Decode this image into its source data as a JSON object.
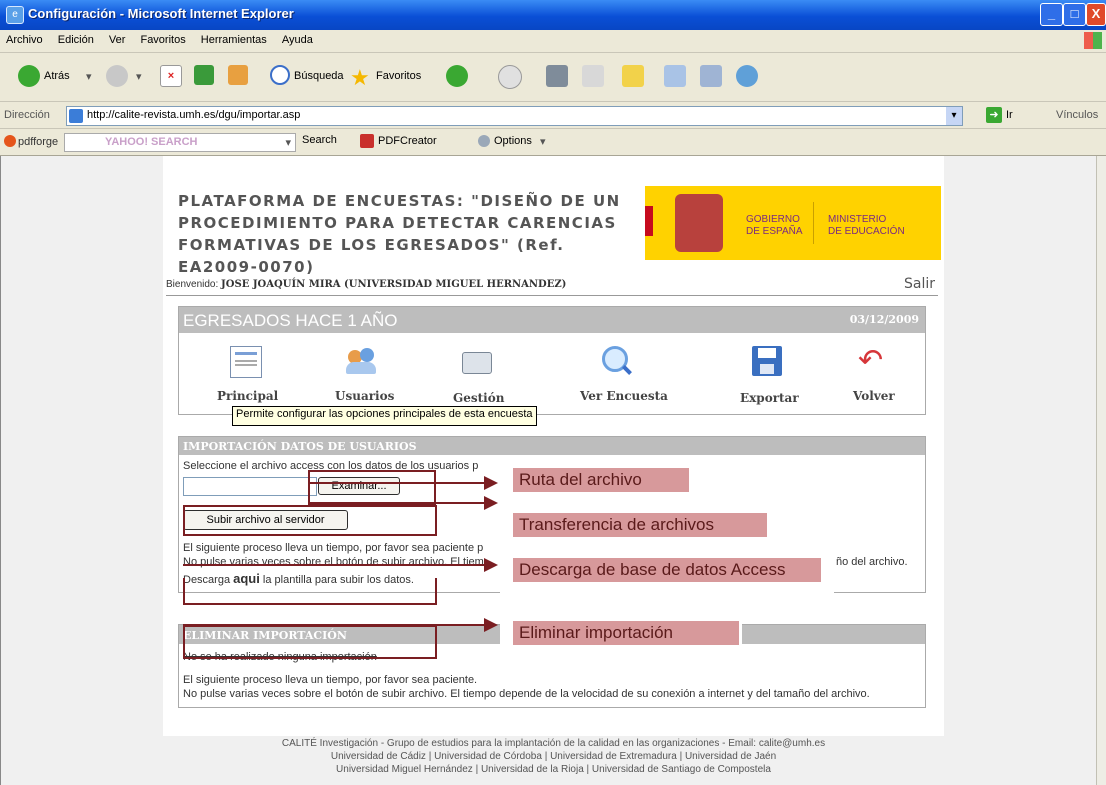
{
  "window": {
    "title": "Configuración - Microsoft Internet Explorer",
    "minimize": "_",
    "maximize": "□",
    "close": "X"
  },
  "menu": [
    "Archivo",
    "Edición",
    "Ver",
    "Favoritos",
    "Herramientas",
    "Ayuda"
  ],
  "toolbar": {
    "back": "Atrás",
    "search": "Búsqueda",
    "favorites": "Favoritos"
  },
  "address": {
    "label": "Dirección",
    "url": "http://calite-revista.umh.es/dgu/importar.asp",
    "go": "Ir",
    "links": "Vínculos"
  },
  "yahoobar": {
    "pdfforge": "pdfforge",
    "search_placeholder": "YAHOO! SEARCH",
    "search_button": "Search",
    "pdfcreator": "PDFCreator",
    "options": "Options"
  },
  "header": {
    "title_lines": [
      "PLATAFORMA DE ENCUESTAS: \"DISEÑO DE UN",
      "PROCEDIMIENTO PARA DETECTAR CARENCIAS",
      "FORMATIVAS DE LOS EGRESADOS\" (Ref. EA2009-0070)"
    ],
    "logo_gob_1": "GOBIERNO",
    "logo_gob_2": "DE ESPAÑA",
    "logo_min_1": "MINISTERIO",
    "logo_min_2": "DE EDUCACIÓN"
  },
  "user": {
    "welcome_label": "Bienvenido:",
    "name": "JOSE JOAQUÍN MIRA (UNIVERSIDAD MIGUEL HERNANDEZ)",
    "logout": "Salir"
  },
  "survey": {
    "title": "EGRESADOS HACE 1 AÑO",
    "date": "03/12/2009",
    "nav": [
      {
        "label": "Principal",
        "icon": "document-icon"
      },
      {
        "label": "Usuarios",
        "icon": "users-icon"
      },
      {
        "label": "Gestión",
        "icon": "drive-icon"
      },
      {
        "label": "Ver Encuesta",
        "icon": "magnifier-icon"
      },
      {
        "label": "Exportar",
        "icon": "floppy-icon"
      },
      {
        "label": "Volver",
        "icon": "back-arrow-icon"
      }
    ],
    "tooltip": "Permite configurar las opciones principales de esta encuesta"
  },
  "import": {
    "title": "IMPORTACIÓN DATOS DE USUARIOS",
    "instruction": "Seleccione el archivo access con los datos de los usuarios p",
    "browse": "Examinar...",
    "upload": "Subir archivo al servidor",
    "note1": "El siguiente proceso lleva un tiempo, por favor sea paciente p",
    "note2": "No pulse varias veces sobre el botón de subir archivo. El tiem",
    "note2_tail": "ño del archivo.",
    "download_pre": "Descarga ",
    "download_link": "aqui",
    "download_post": " la plantilla para subir los datos."
  },
  "delete": {
    "title": "ELIMINAR IMPORTACIÓN",
    "status": "No se ha realizado ninguna importación",
    "note1": "El siguiente proceso lleva un tiempo, por favor sea paciente.",
    "note2": "No pulse varias veces sobre el botón de subir archivo. El tiempo depende de la velocidad de su conexión a internet y del tamaño del archivo."
  },
  "callouts": {
    "path": "Ruta del archivo",
    "transfer": "Transferencia de archivos",
    "download": "Descarga de base de datos Access",
    "delete": "Eliminar importación"
  },
  "footer": {
    "line1": "CALITÉ Investigación - Grupo de estudios para la implantación de la calidad en las organizaciones - Email: calite@umh.es",
    "line2": "Universidad de Cádiz | Universidad de Córdoba | Universidad de Extremadura | Universidad de Jaén",
    "line3": "Universidad Miguel Hernández | Universidad de la Rioja | Universidad de Santiago de Compostela"
  }
}
